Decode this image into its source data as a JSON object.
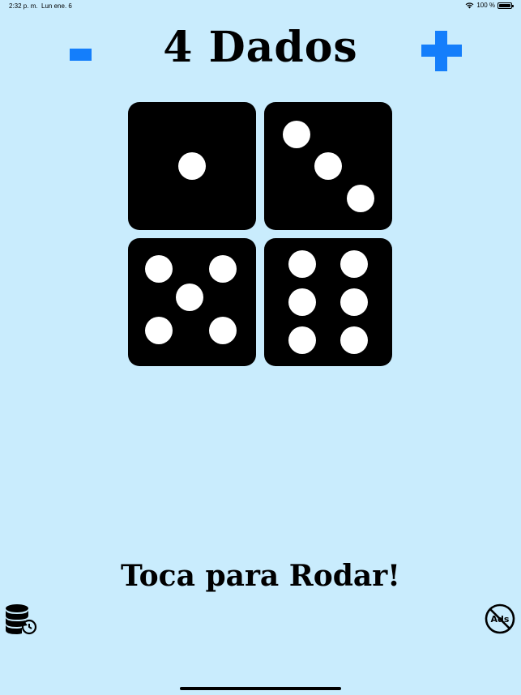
{
  "status_bar": {
    "time": "2:32 p. m.",
    "date": "Lun ene. 6",
    "battery": "100 %"
  },
  "header": {
    "title": "4 Dados",
    "minus_icon": "minus-icon",
    "plus_icon": "plus-icon",
    "accent_color": "#147efb"
  },
  "dice": [
    {
      "value": 1
    },
    {
      "value": 3
    },
    {
      "value": 5
    },
    {
      "value": 6
    }
  ],
  "footer": {
    "tap_text": "Toca para Rodar!",
    "history_icon": "database-history-icon",
    "no_ads_label": "Ads",
    "no_ads_icon": "no-ads-icon"
  },
  "colors": {
    "background": "#c9ecfd",
    "die": "#000000",
    "pip": "#ffffff"
  }
}
